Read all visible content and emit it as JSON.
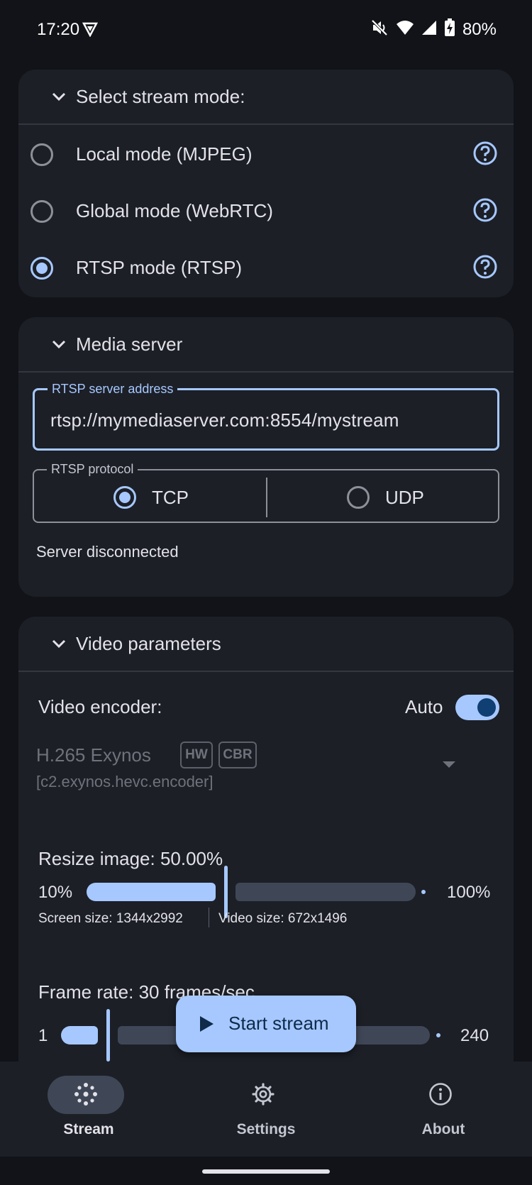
{
  "status_bar": {
    "time": "17:20",
    "battery": "80%"
  },
  "stream_mode": {
    "title": "Select stream mode:",
    "options": [
      {
        "label": "Local mode (MJPEG)",
        "selected": false
      },
      {
        "label": "Global mode (WebRTC)",
        "selected": false
      },
      {
        "label": "RTSP mode (RTSP)",
        "selected": true
      }
    ]
  },
  "media_server": {
    "title": "Media server",
    "address_label": "RTSP server address",
    "address_value": "rtsp://mymediaserver.com:8554/mystream",
    "protocol_label": "RTSP protocol",
    "protocol_options": [
      "TCP",
      "UDP"
    ],
    "protocol_selected": "TCP",
    "status": "Server disconnected"
  },
  "video_params": {
    "title": "Video parameters",
    "encoder_label": "Video encoder:",
    "auto_label": "Auto",
    "auto_enabled": true,
    "encoder_name": "H.265 Exynos",
    "encoder_badges": [
      "HW",
      "CBR"
    ],
    "encoder_id": "[c2.exynos.hevc.encoder]",
    "resize": {
      "label": "Resize image: 50.00%",
      "min": "10%",
      "max": "100%",
      "value_fraction": 0.44,
      "screen_size": "Screen size: 1344x2992",
      "video_size": "Video size: 672x1496"
    },
    "frame_rate": {
      "label": "Frame rate: 30 frames/sec",
      "min": "1",
      "max": "240",
      "value": 30
    }
  },
  "fab": {
    "label": "Start stream",
    "icon": "play-icon"
  },
  "bottom_nav": [
    {
      "label": "Stream",
      "icon": "stream-icon",
      "active": true
    },
    {
      "label": "Settings",
      "icon": "gear-icon",
      "active": false
    },
    {
      "label": "About",
      "icon": "info-icon",
      "active": false
    }
  ],
  "colors": {
    "accent": "#a6c8ff",
    "surface": "#1c1f26",
    "background": "#111318"
  }
}
